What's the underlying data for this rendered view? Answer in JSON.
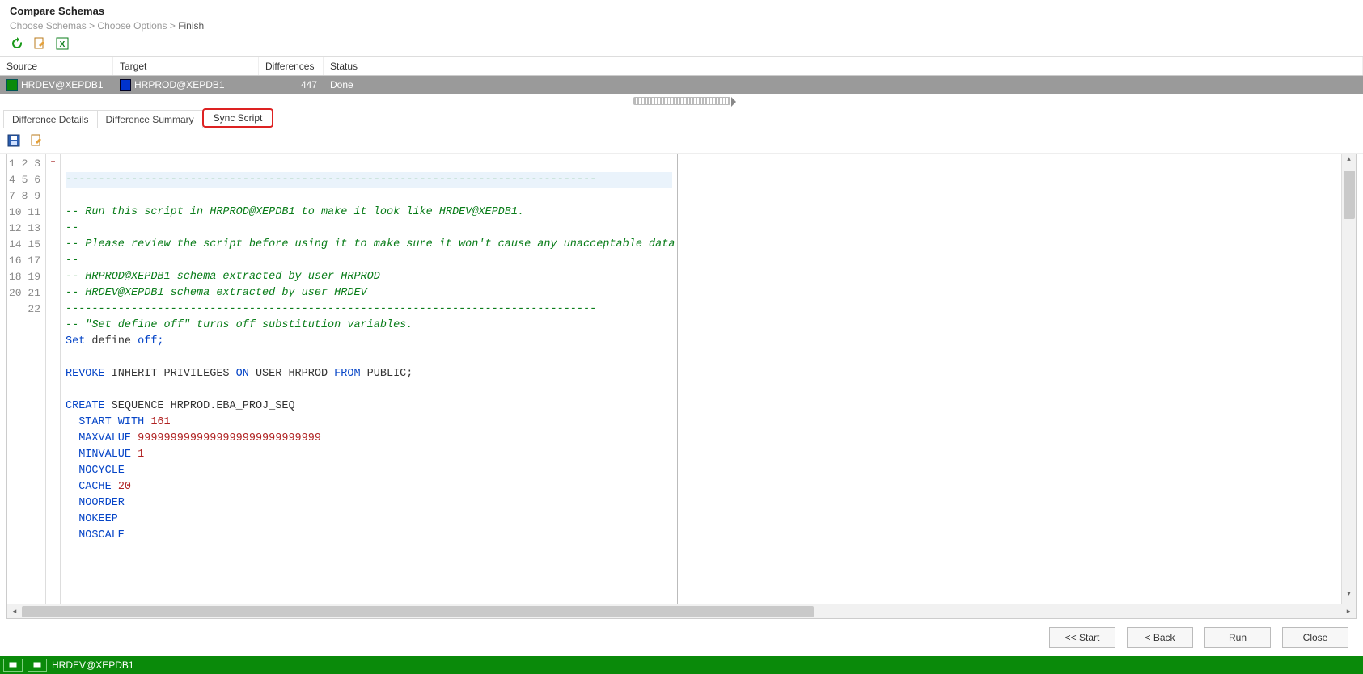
{
  "title": "Compare Schemas",
  "breadcrumb": {
    "a": "Choose Schemas",
    "b": "Choose Options",
    "c": "Finish",
    "sep": ">"
  },
  "grid": {
    "headers": {
      "source": "Source",
      "target": "Target",
      "diff": "Differences",
      "status": "Status"
    },
    "row": {
      "source": "HRDEV@XEPDB1",
      "target": "HRPROD@XEPDB1",
      "diff": "447",
      "status": "Done"
    }
  },
  "tabs": {
    "t1": "Difference Details",
    "t2": "Difference Summary",
    "t3": "Sync Script"
  },
  "code": {
    "l1": "---------------------------------------------------------------------------------",
    "l2": "-- Run this script in HRPROD@XEPDB1 to make it look like HRDEV@XEPDB1.",
    "l3": "--",
    "l4": "-- Please review the script before using it to make sure it won't cause any unacceptable data loss.",
    "l5": "--",
    "l6": "-- HRPROD@XEPDB1 schema extracted by user HRPROD",
    "l7": "-- HRDEV@XEPDB1 schema extracted by user HRDEV",
    "l8": "---------------------------------------------------------------------------------",
    "l9": "-- \"Set define off\" turns off substitution variables.",
    "l10_a": "Set",
    "l10_b": " define ",
    "l10_c": "off;",
    "l12_a": "REVOKE",
    "l12_b": " INHERIT PRIVILEGES ",
    "l12_c": "ON",
    "l12_d": " USER HRPROD ",
    "l12_e": "FROM",
    "l12_f": " PUBLIC;",
    "l14_a": "CREATE",
    "l14_b": " SEQUENCE HRPROD.EBA_PROJ_SEQ",
    "l15_a": "  START WITH",
    "l15_b": " 161",
    "l16_a": "  MAXVALUE",
    "l16_b": " 9999999999999999999999999999",
    "l17_a": "  MINVALUE",
    "l17_b": " 1",
    "l18": "  NOCYCLE",
    "l19_a": "  CACHE",
    "l19_b": " 20",
    "l20": "  NOORDER",
    "l21": "  NOKEEP",
    "l22": "  NOSCALE"
  },
  "linecount": 22,
  "buttons": {
    "start": "<< Start",
    "back": "< Back",
    "run": "Run",
    "close": "Close"
  },
  "status": "HRDEV@XEPDB1"
}
